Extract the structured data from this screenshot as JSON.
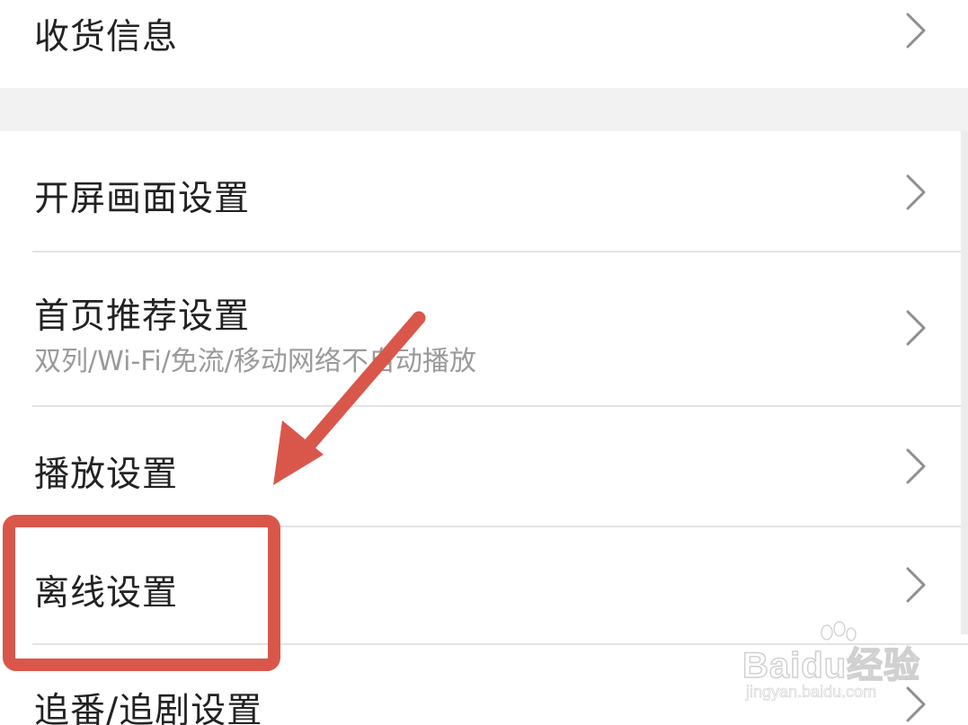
{
  "settings": {
    "shipping_info": {
      "label": "收货信息"
    },
    "splash_screen": {
      "label": "开屏画面设置"
    },
    "home_recommend": {
      "label": "首页推荐设置",
      "subtitle": "双列/Wi-Fi/免流/移动网络不自动播放"
    },
    "playback": {
      "label": "播放设置"
    },
    "offline": {
      "label": "离线设置"
    },
    "follow": {
      "label": "追番/追剧设置"
    }
  },
  "annotation": {
    "highlight_color": "#d9574a",
    "arrow_color": "#d9574a"
  },
  "watermark": {
    "main": "Baidu经验",
    "url": "jingyan.baidu.com"
  },
  "icons": {
    "chevron": "chevron-right-icon"
  }
}
